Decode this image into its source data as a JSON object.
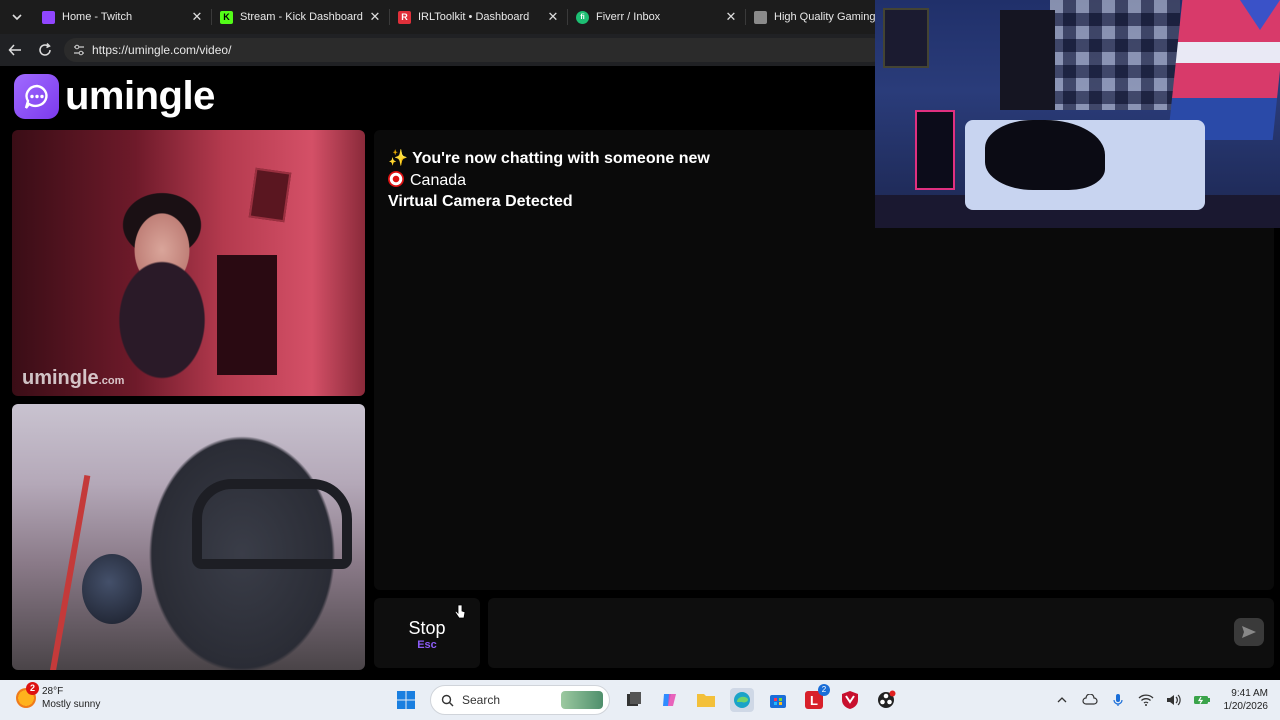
{
  "browser": {
    "tabs": [
      {
        "title": "Home - Twitch",
        "favicon_color": "#9146ff",
        "favicon_glyph": ""
      },
      {
        "title": "Stream - Kick Dashboard",
        "favicon_color": "#53fc18",
        "favicon_glyph": "K"
      },
      {
        "title": "IRLToolkit • Dashboard",
        "favicon_color": "#e0303a",
        "favicon_glyph": "R"
      },
      {
        "title": "Fiverr / Inbox",
        "favicon_color": "#1dbf73",
        "favicon_glyph": "fi"
      },
      {
        "title": "High Quality Gaming Ge",
        "favicon_color": "#8a8a8a",
        "favicon_glyph": ""
      }
    ],
    "url": "https://umingle.com/video/"
  },
  "site": {
    "brand": "umingle",
    "brand_color": "#8b5cf6"
  },
  "self_cam": {
    "watermark": "umingle",
    "watermark_suffix": ".com"
  },
  "chat": {
    "messages": [
      {
        "icon": "sparkles",
        "text": "✨ You're now chatting with someone new"
      },
      {
        "icon": "canada-flag",
        "text": "Canada"
      },
      {
        "icon": "",
        "text": "Virtual Camera Detected"
      }
    ],
    "stop_label": "Stop",
    "stop_key": "Esc"
  },
  "taskbar": {
    "weather": {
      "temp": "28°F",
      "condition": "Mostly sunny",
      "badge": "2"
    },
    "search_label": "Search",
    "app_badge": "2",
    "time": "9:41 AM",
    "date": "1/20/2026"
  }
}
